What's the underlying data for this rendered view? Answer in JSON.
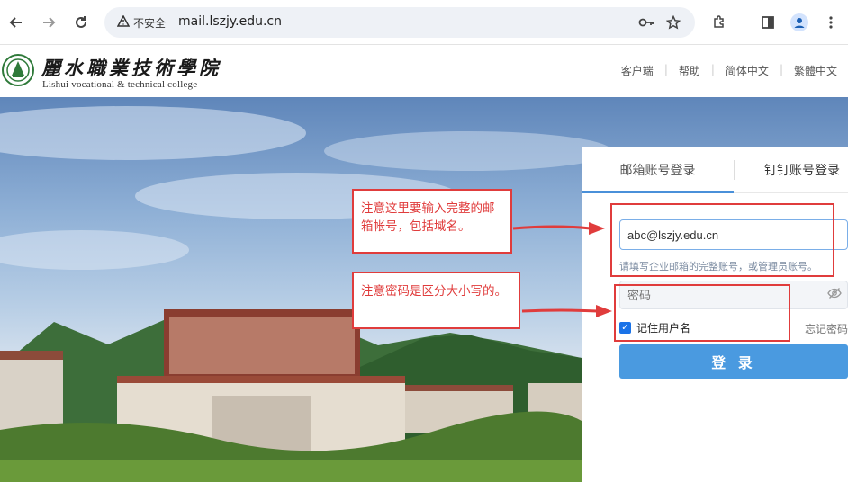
{
  "browser": {
    "security_label": "不安全",
    "url": "mail.lszjy.edu.cn",
    "icons": [
      "back-icon",
      "forward-icon",
      "reload-icon",
      "warning-icon",
      "key-icon",
      "star-icon",
      "extension-icon",
      "sidebar-icon",
      "profile-icon",
      "menu-icon"
    ]
  },
  "site": {
    "logo_cn": "麗水職業技術學院",
    "logo_en": "Lishui vocational & technical college",
    "links": [
      "客户端",
      "帮助",
      "简体中文",
      "繁體中文"
    ]
  },
  "login": {
    "tabs": [
      "邮箱账号登录",
      "钉钉账号登录"
    ],
    "email_value": "abc@lszjy.edu.cn",
    "email_hint": "请填写企业邮箱的完整账号，或管理员账号。",
    "password_placeholder": "密码",
    "remember_label": "记住用户名",
    "forgot_label": "忘记密码",
    "login_button": "登 录"
  },
  "annotations": {
    "email_note": "注意这里要输入完整的邮箱帐号，包括域名。",
    "password_note": "注意密码是区分大小写的。"
  },
  "colors": {
    "accent": "#4a9ae0",
    "annotation": "#e03c3c"
  }
}
